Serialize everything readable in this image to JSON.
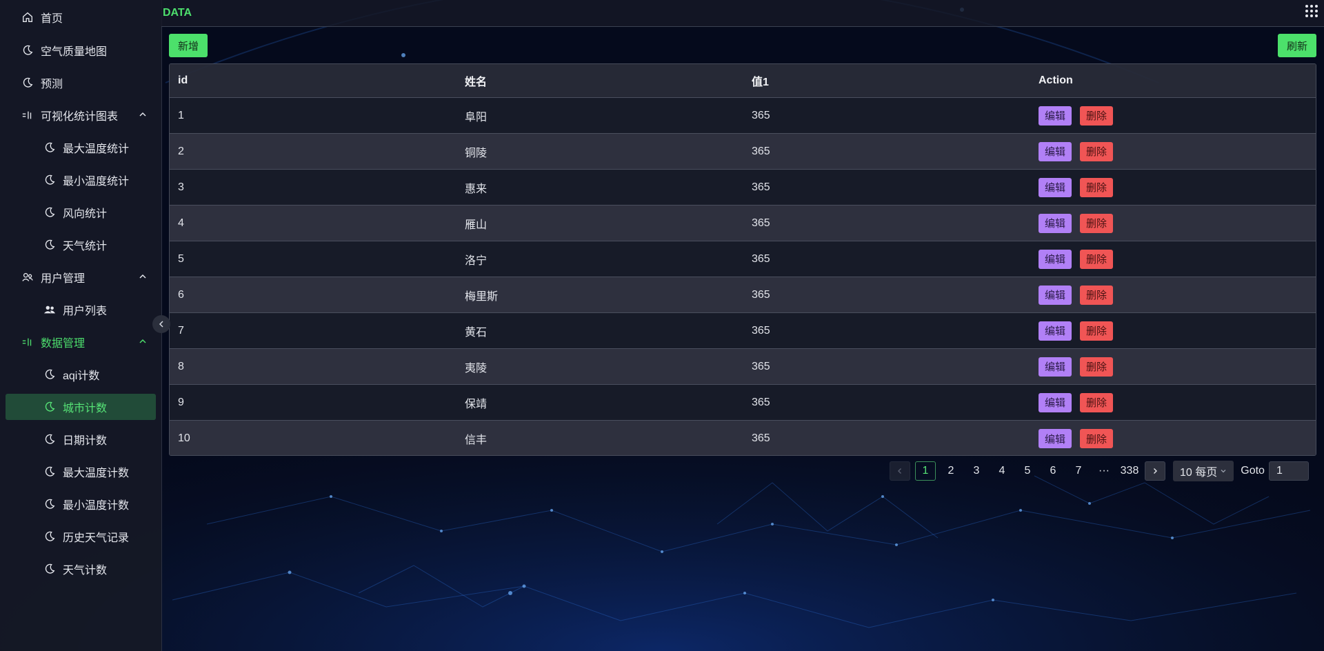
{
  "header": {
    "title": "DATA"
  },
  "sidebar": {
    "items": [
      {
        "label": "首页",
        "icon": "home-icon"
      },
      {
        "label": "空气质量地图",
        "icon": "moon-icon"
      },
      {
        "label": "预测",
        "icon": "moon-icon"
      },
      {
        "label": "可视化统计图表",
        "icon": "chart-group-icon",
        "expanded": true
      },
      {
        "label": "最大温度统计",
        "icon": "moon-icon"
      },
      {
        "label": "最小温度统计",
        "icon": "moon-icon"
      },
      {
        "label": "风向统计",
        "icon": "moon-icon"
      },
      {
        "label": "天气统计",
        "icon": "moon-icon"
      },
      {
        "label": "用户管理",
        "icon": "users-icon",
        "expanded": true
      },
      {
        "label": "用户列表",
        "icon": "user-group-icon"
      },
      {
        "label": "数据管理",
        "icon": "chart-group-icon",
        "expanded": true
      },
      {
        "label": "aqi计数",
        "icon": "moon-icon"
      },
      {
        "label": "城市计数",
        "icon": "moon-icon",
        "active": true
      },
      {
        "label": "日期计数",
        "icon": "moon-icon"
      },
      {
        "label": "最大温度计数",
        "icon": "moon-icon"
      },
      {
        "label": "最小温度计数",
        "icon": "moon-icon"
      },
      {
        "label": "历史天气记录",
        "icon": "moon-icon"
      },
      {
        "label": "天气计数",
        "icon": "moon-icon"
      }
    ]
  },
  "toolbar": {
    "add_label": "新增",
    "refresh_label": "刷新"
  },
  "table": {
    "columns": [
      "id",
      "姓名",
      "值1",
      "Action"
    ],
    "edit_label": "编辑",
    "delete_label": "删除",
    "rows": [
      [
        "1",
        "阜阳",
        "365"
      ],
      [
        "2",
        "铜陵",
        "365"
      ],
      [
        "3",
        "惠来",
        "365"
      ],
      [
        "4",
        "雁山",
        "365"
      ],
      [
        "5",
        "洛宁",
        "365"
      ],
      [
        "6",
        "梅里斯",
        "365"
      ],
      [
        "7",
        "黄石",
        "365"
      ],
      [
        "8",
        "夷陵",
        "365"
      ],
      [
        "9",
        "保靖",
        "365"
      ],
      [
        "10",
        "信丰",
        "365"
      ]
    ]
  },
  "pagination": {
    "pages": [
      "1",
      "2",
      "3",
      "4",
      "5",
      "6",
      "7",
      "···",
      "338"
    ],
    "current": "1",
    "page_size": "10 每页",
    "goto_label": "Goto",
    "goto_value": "1"
  },
  "colors": {
    "accent": "#4ce06b",
    "edit": "#b180f6",
    "delete": "#f05555",
    "background": "#060b1e"
  }
}
